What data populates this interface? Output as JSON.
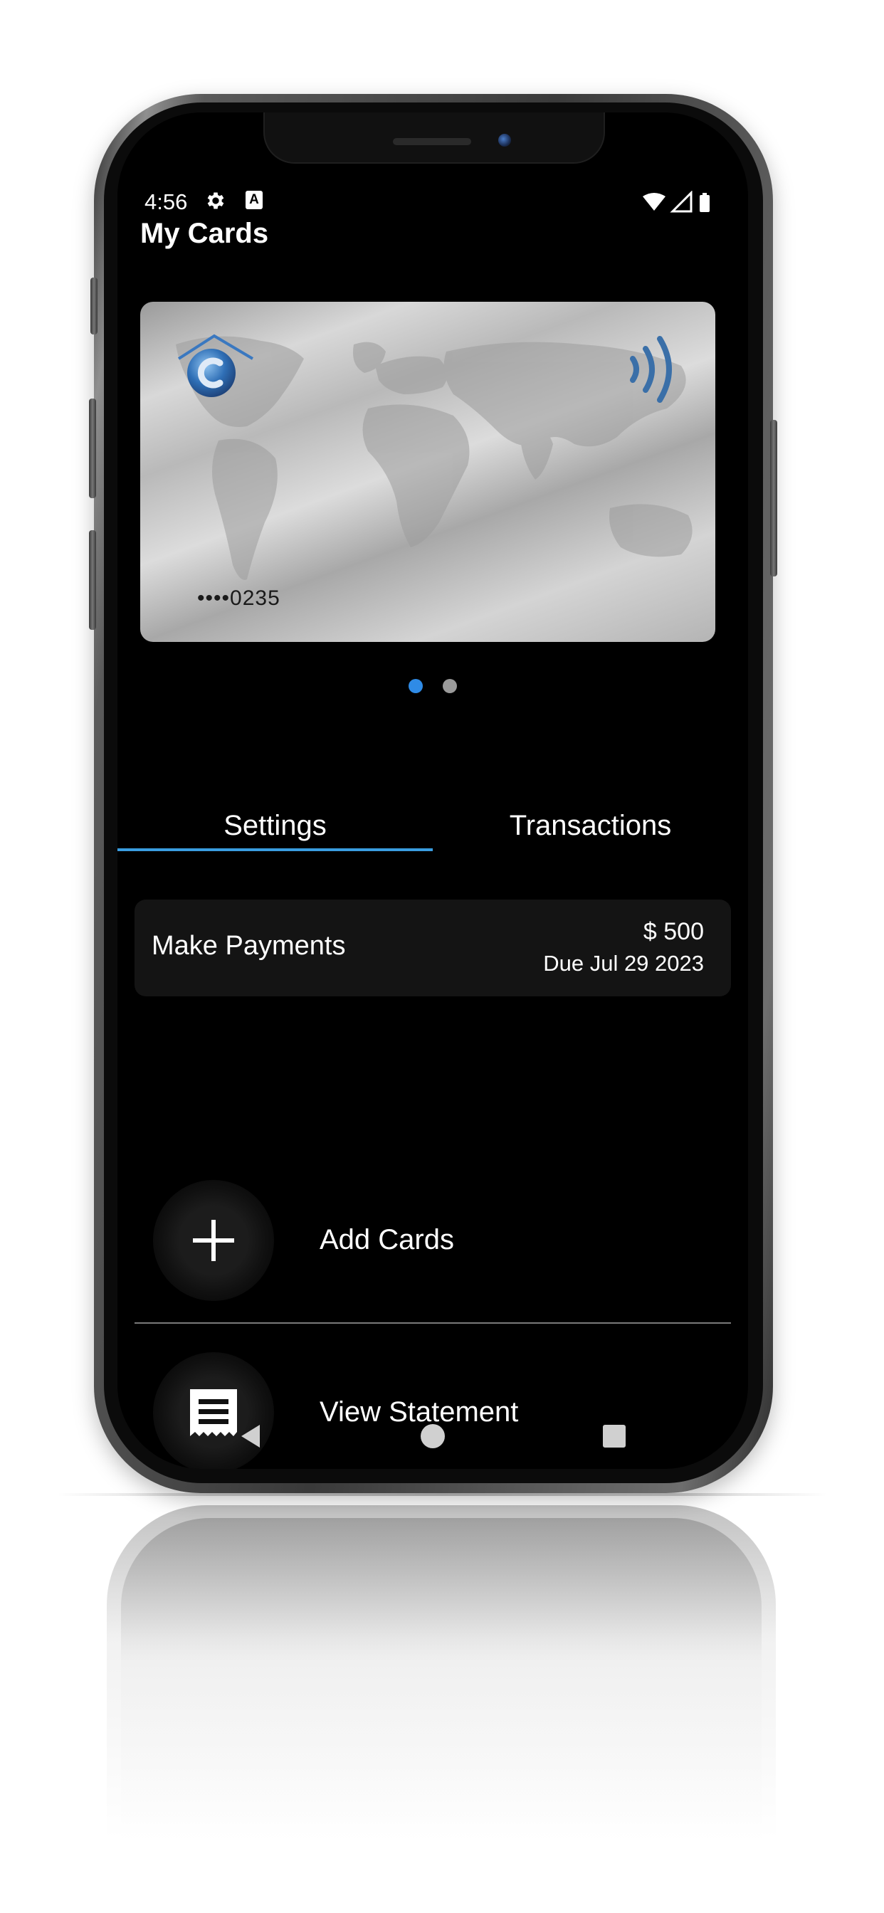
{
  "status_bar": {
    "time": "4:56",
    "settings_icon": "gear-icon",
    "accessibility_icon": "a-icon",
    "accessibility_label": "A",
    "wifi_icon": "wifi-icon",
    "signal_icon": "signal-icon",
    "battery_icon": "battery-icon"
  },
  "header": {
    "title": "My Cards"
  },
  "card": {
    "number_masked": "••••0235",
    "logo_icon": "bank-logo-icon",
    "contactless_icon": "contactless-icon"
  },
  "pager": {
    "count": 2,
    "active_index": 0
  },
  "tabs": [
    {
      "label": "Settings",
      "active": true
    },
    {
      "label": "Transactions",
      "active": false
    }
  ],
  "payment": {
    "label": "Make Payments",
    "amount": "$ 500",
    "due": "Due Jul 29 2023"
  },
  "actions": [
    {
      "label": "Add Cards",
      "icon": "plus-icon"
    },
    {
      "label": "View Statement",
      "icon": "receipt-icon"
    }
  ],
  "nav": {
    "back_icon": "back-triangle-icon",
    "home_icon": "home-circle-icon",
    "recents_icon": "recents-square-icon"
  },
  "colors": {
    "accent": "#3a9de0",
    "dot_active": "#2f8be6",
    "dot_inactive": "#9a9a9a",
    "background": "#000000",
    "surface": "#141414"
  }
}
